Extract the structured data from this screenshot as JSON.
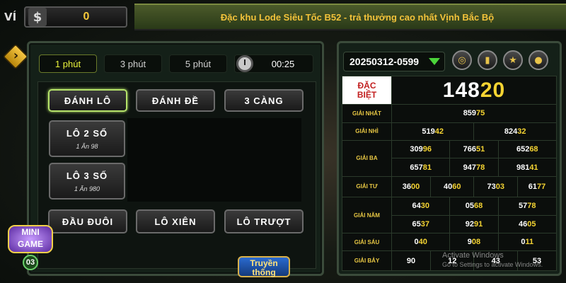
{
  "wallet": {
    "label": "VÍ",
    "currency_symbol": "$",
    "balance": "0"
  },
  "marquee": "Đặc khu Lode Siêu Tốc B52 - trả thưởng cao nhất Vịnh Bắc Bộ",
  "left_panel": {
    "tabs": [
      {
        "label": "1 phút",
        "active": true
      },
      {
        "label": "3 phút",
        "active": false
      },
      {
        "label": "5 phút",
        "active": false
      }
    ],
    "timer": "00:25",
    "bet_types": [
      {
        "label": "ĐÁNH LÔ",
        "selected": true
      },
      {
        "label": "ĐÁNH ĐỀ",
        "selected": false
      },
      {
        "label": "3 CÀNG",
        "selected": false
      }
    ],
    "sub_types": [
      {
        "label": "LÔ 2 SỐ",
        "rate": "1 Ăn 98"
      },
      {
        "label": "LÔ 3 SỐ",
        "rate": "1 Ăn 980"
      }
    ],
    "bottom_buttons": [
      {
        "label": "ĐẦU ĐUÔI"
      },
      {
        "label": "LÔ XIÊN"
      },
      {
        "label": "LÔ TRƯỢT"
      }
    ]
  },
  "mini_game": {
    "line1": "MINI",
    "line2": "GAME",
    "count": "03"
  },
  "truyen_thong": {
    "line1": "Truyền",
    "line2": "thống"
  },
  "right_panel": {
    "session": "20250312-0599",
    "icons": [
      "globe-icon",
      "chart-icon",
      "star-card-icon",
      "chat-icon"
    ],
    "results": {
      "dac_biet": {
        "label1": "ĐẶC",
        "label2": "BIỆT",
        "prefix": "148",
        "suffix": "20"
      },
      "giai_nhat": {
        "label": "GIẢI NHẤT",
        "numbers": [
          {
            "p": "859",
            "s": "75"
          }
        ]
      },
      "giai_nhi": {
        "label": "GIẢI NHÌ",
        "numbers": [
          {
            "p": "519",
            "s": "42"
          },
          {
            "p": "824",
            "s": "32"
          }
        ]
      },
      "giai_ba": {
        "label": "GIẢI BA",
        "numbers": [
          {
            "p": "309",
            "s": "96"
          },
          {
            "p": "766",
            "s": "51"
          },
          {
            "p": "652",
            "s": "68"
          },
          {
            "p": "657",
            "s": "81"
          },
          {
            "p": "947",
            "s": "78"
          },
          {
            "p": "981",
            "s": "41"
          }
        ]
      },
      "giai_tu": {
        "label": "GIẢI TƯ",
        "numbers": [
          {
            "p": "36",
            "s": "00"
          },
          {
            "p": "40",
            "s": "60"
          },
          {
            "p": "73",
            "s": "03"
          },
          {
            "p": "61",
            "s": "77"
          }
        ]
      },
      "giai_nam": {
        "label": "GIẢI NĂM",
        "numbers": [
          {
            "p": "64",
            "s": "30"
          },
          {
            "p": "05",
            "s": "68"
          },
          {
            "p": "57",
            "s": "78"
          },
          {
            "p": "65",
            "s": "37"
          },
          {
            "p": "92",
            "s": "91"
          },
          {
            "p": "46",
            "s": "05"
          }
        ]
      },
      "giai_sau": {
        "label": "GIẢI SÁU",
        "numbers": [
          {
            "p": "0",
            "s": "40"
          },
          {
            "p": "9",
            "s": "08"
          },
          {
            "p": "0",
            "s": "11"
          }
        ]
      },
      "giai_bay": {
        "label": "GIẢI BẢY",
        "numbers": [
          {
            "p": "",
            "s": "90"
          },
          {
            "p": "",
            "s": "12"
          },
          {
            "p": "",
            "s": "43"
          },
          {
            "p": "",
            "s": "53"
          }
        ]
      }
    }
  },
  "watermark": {
    "line1": "Activate Windows",
    "line2": "Go to Settings to activate Windows."
  }
}
